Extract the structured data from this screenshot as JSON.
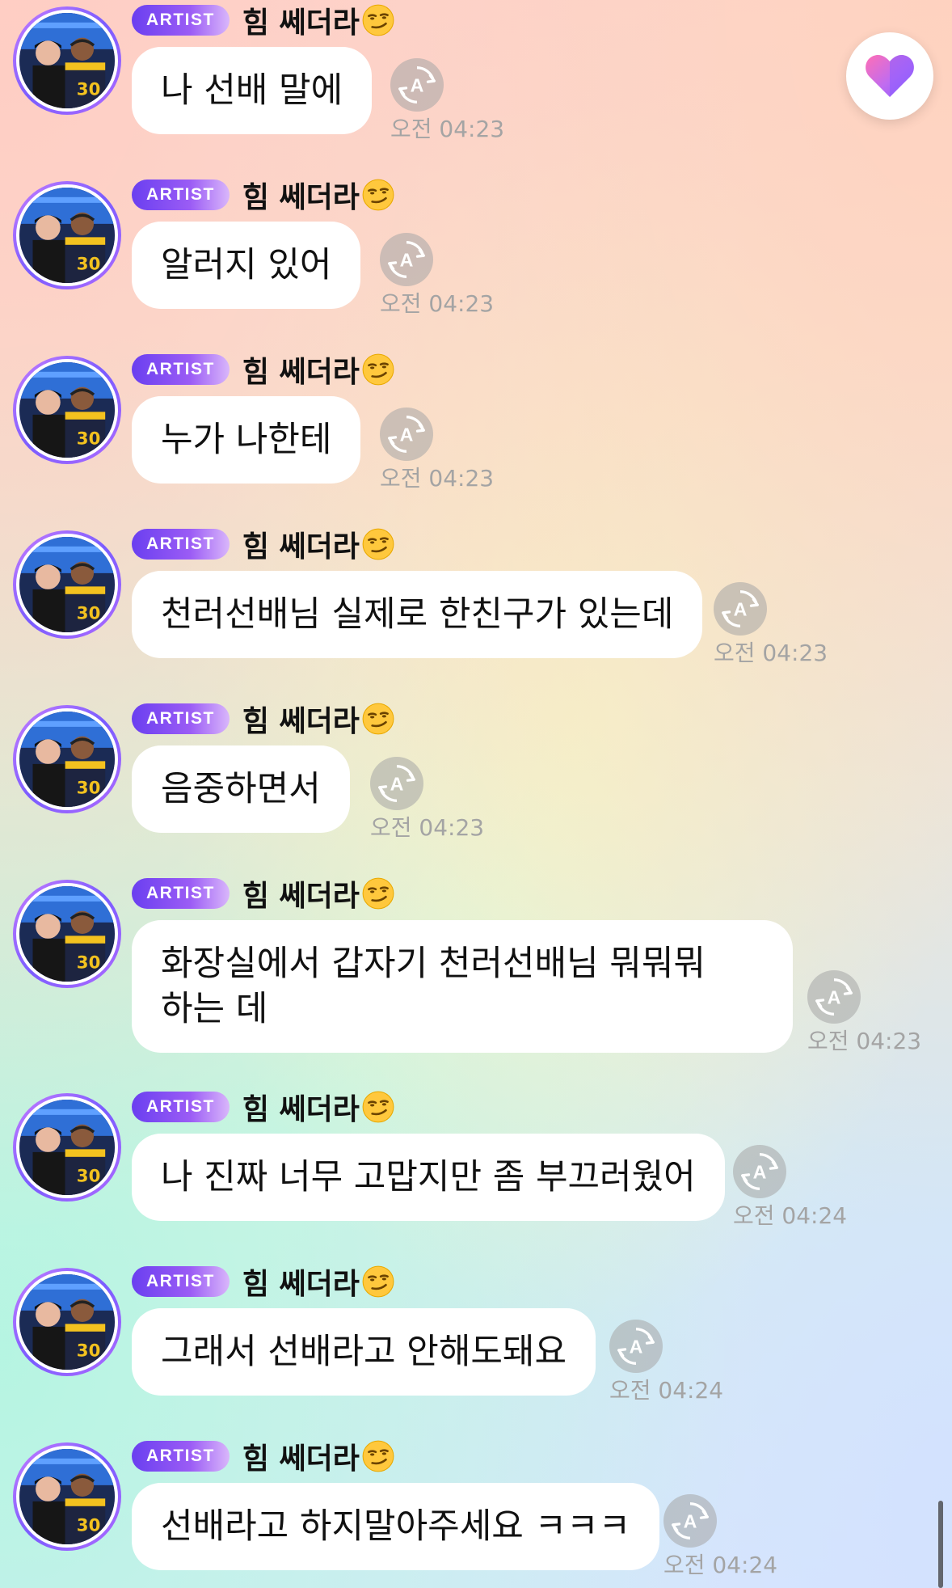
{
  "sender": {
    "badge": "ARTIST",
    "name": "힘 쎄더라",
    "name_emoji": "smirk-emoji-icon",
    "avatar": "artist-avatar"
  },
  "translate_icon": "auto-translate-icon",
  "favorite_icon": "heart-icon",
  "colors": {
    "badge_start": "#6a3ff0",
    "badge_end": "#d9b6fb",
    "avatar_ring": "#7a5cff",
    "heart_pink": "#ff6fb5",
    "heart_purple": "#8a5cff",
    "timestamp": "#a4a4a4"
  },
  "messages": [
    {
      "text": "나 선배 말에",
      "time": "오전 04:23"
    },
    {
      "text": "알러지 있어",
      "time": "오전 04:23"
    },
    {
      "text": "누가 나한테",
      "time": "오전 04:23"
    },
    {
      "text": "천러선배님 실제로 한친구가 있는데",
      "time": "오전 04:23"
    },
    {
      "text": "음중하면서",
      "time": "오전 04:23"
    },
    {
      "text": "화장실에서 갑자기 천러선배님 뭐뭐뭐 하는 데",
      "time": "오전 04:23"
    },
    {
      "text": "나 진짜 너무 고맙지만 좀 부끄러웠어",
      "time": "오전 04:24"
    },
    {
      "text": "그래서 선배라고 안해도돼요",
      "time": "오전 04:24"
    },
    {
      "text": "선배라고 하지말아주세요 ㅋㅋㅋ",
      "time": "오전 04:24"
    }
  ]
}
